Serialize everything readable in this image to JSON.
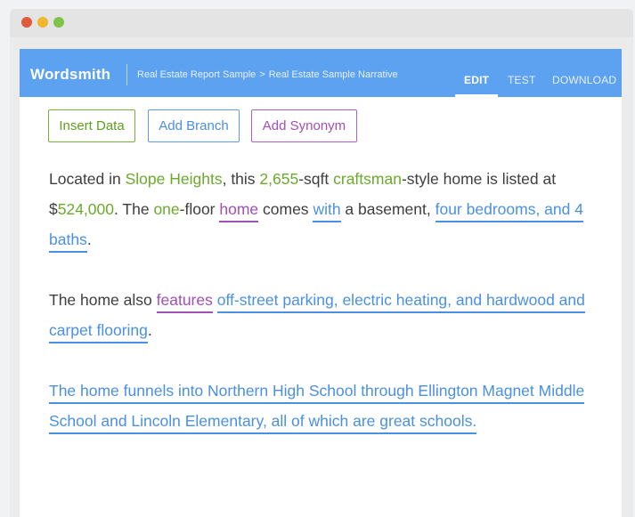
{
  "app": {
    "brand": "Wordsmith",
    "breadcrumb": [
      "Real Estate Report Sample",
      "Real Estate Sample Narrative"
    ],
    "breadcrumb_separator": ">",
    "nav": [
      "EDIT",
      "TEST",
      "DOWNLOAD"
    ],
    "active_nav": "EDIT"
  },
  "toolbar": {
    "insert_label": "Insert Data",
    "branch_label": "Add Branch",
    "synonym_label": "Add Synonym"
  },
  "colors": {
    "appbar": "#5da2f0",
    "data": "#6aaa2c",
    "branch": "#4a90e2",
    "synonym": "#a24fb8"
  },
  "narrative": {
    "p1": {
      "t1": "Located in ",
      "d_neighborhood": "Slope Heights",
      "t2": ", this ",
      "d_sqft": "2,655",
      "t3": "-sqft ",
      "d_style": "craftsman",
      "t4": "-style home is listed at $",
      "d_price": "524,000",
      "t5": ". The ",
      "d_floors": "one",
      "t6": "-floor ",
      "s_home": "home",
      "t7": " comes ",
      "b_with": "with",
      "t8": " a basement, ",
      "b_rooms": "four bedrooms, and 4 baths",
      "t9": "."
    },
    "p2": {
      "t1": "The home also ",
      "s_features": "features",
      "t2": " ",
      "b_amenities": "off-street parking, electric heating, and hardwood and carpet flooring",
      "t3": "."
    },
    "p3": {
      "b_schools": "The home funnels into Northern High School through Ellington Magnet Middle School and Lincoln Elementary, all of which are great schools."
    }
  }
}
